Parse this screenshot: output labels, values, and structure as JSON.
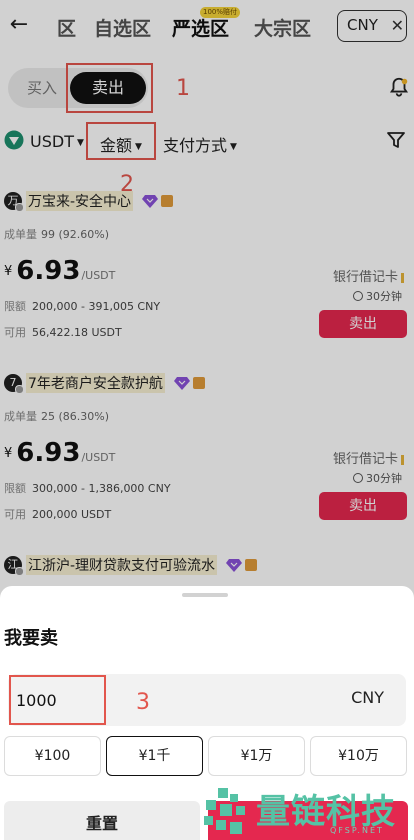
{
  "nav": {
    "tabs": [
      "区",
      "自选区",
      "严选区",
      "大宗区"
    ],
    "active_tab": "严选区",
    "tab_badge": "100%赔付",
    "currency": "CNY"
  },
  "trade_switch": {
    "buy": "买入",
    "sell": "卖出",
    "active": "卖出"
  },
  "filters": {
    "coin": "USDT",
    "amount": "金额",
    "payment": "支付方式"
  },
  "annotations": {
    "a1": "1",
    "a2": "2",
    "a3": "3"
  },
  "ads": [
    {
      "avatar": "万",
      "name": "万宝来-安全中心",
      "stats_label": "成单量",
      "stats_value": "99 (92.60%)",
      "currency_symbol": "¥",
      "price": "6.93",
      "price_unit": "/USDT",
      "limit_label": "限额",
      "limit_value": "200,000 - 391,005 CNY",
      "avail_label": "可用",
      "avail_value": "56,422.18 USDT",
      "payment_method": "银行借记卡",
      "time_limit": "30分钟",
      "action": "卖出"
    },
    {
      "avatar": "7",
      "name": "7年老商户安全款护航",
      "stats_label": "成单量",
      "stats_value": "25 (86.30%)",
      "currency_symbol": "¥",
      "price": "6.93",
      "price_unit": "/USDT",
      "limit_label": "限额",
      "limit_value": "300,000 - 1,386,000 CNY",
      "avail_label": "可用",
      "avail_value": "200,000 USDT",
      "payment_method": "银行借记卡",
      "time_limit": "30分钟",
      "action": "卖出"
    },
    {
      "avatar": "江",
      "name": "江浙沪-理财贷款支付可验流水"
    }
  ],
  "sheet": {
    "title": "我要卖",
    "amount_value": "1000",
    "amount_currency": "CNY",
    "presets": [
      "¥100",
      "¥1千",
      "¥1万",
      "¥10万"
    ],
    "active_preset": "¥1千",
    "reset": "重置"
  },
  "watermark": {
    "text": "量链科技",
    "sub": "QFSP.NET"
  },
  "colors": {
    "accent_red": "#e4284f",
    "annotation_red": "#e2564d",
    "watermark_green": "#55c2a5"
  }
}
